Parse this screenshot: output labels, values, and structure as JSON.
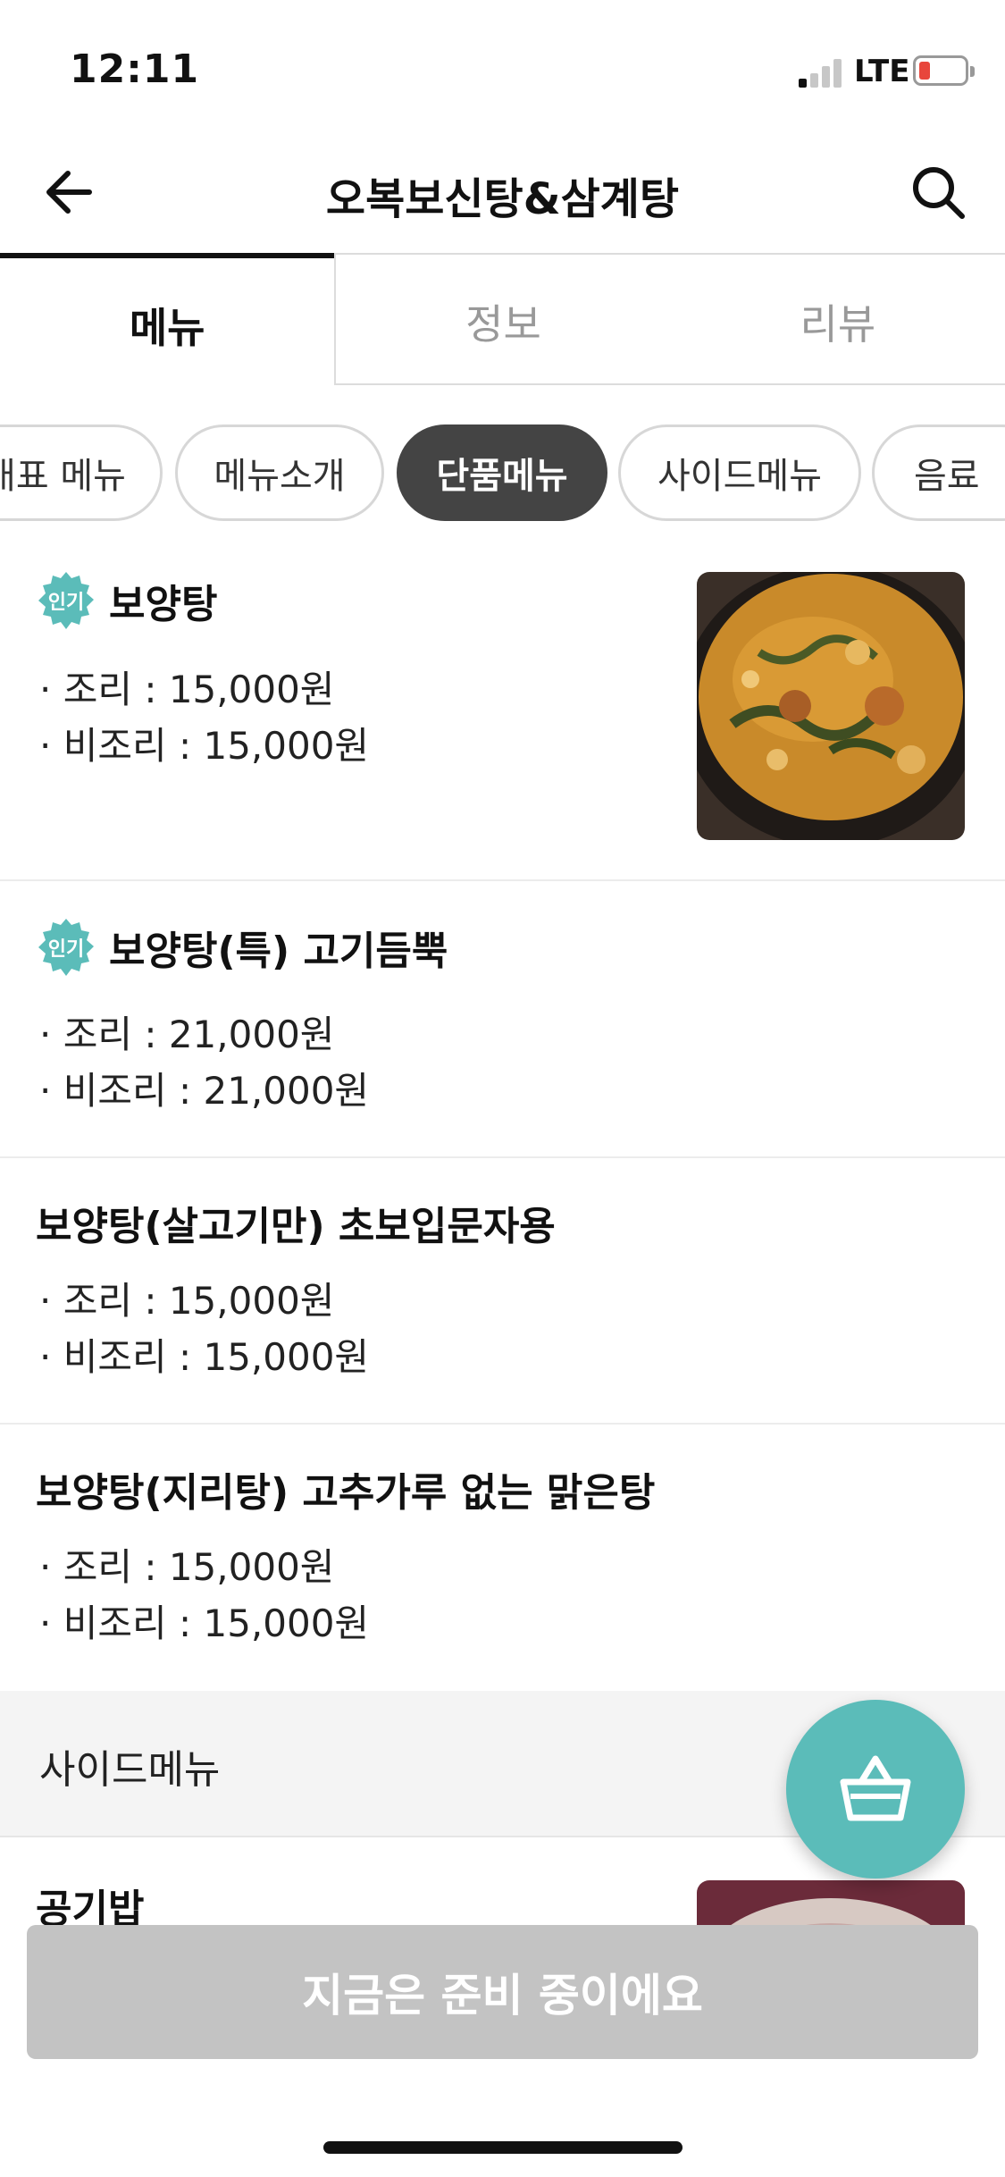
{
  "status_bar": {
    "time": "12:11",
    "network": "LTE"
  },
  "header": {
    "title": "오복보신탕&삼계탕",
    "back_icon": "arrow-left-icon",
    "search_icon": "search-icon"
  },
  "tabs": [
    {
      "label": "메뉴",
      "active": true
    },
    {
      "label": "정보",
      "active": false
    },
    {
      "label": "리뷰",
      "active": false
    }
  ],
  "category_chips": [
    {
      "label": "대표 메뉴",
      "active": false
    },
    {
      "label": "메뉴소개",
      "active": false
    },
    {
      "label": "단품메뉴",
      "active": true
    },
    {
      "label": "사이드메뉴",
      "active": false
    },
    {
      "label": "음료",
      "active": false
    }
  ],
  "menu_items": [
    {
      "badge": "인기",
      "name": "보양탕",
      "prices": [
        "· 조리 : 15,000원",
        "· 비조리 : 15,000원"
      ],
      "has_image": true
    },
    {
      "badge": "인기",
      "name": "보양탕(특) 고기듬뿍",
      "prices": [
        "· 조리 : 21,000원",
        "· 비조리 : 21,000원"
      ],
      "has_image": false
    },
    {
      "badge": "",
      "name": "보양탕(살고기만) 초보입문자용",
      "prices": [
        "· 조리 : 15,000원",
        "· 비조리 : 15,000원"
      ],
      "has_image": false
    },
    {
      "badge": "",
      "name": "보양탕(지리탕) 고추가루 없는 맑은탕",
      "prices": [
        "· 조리 : 15,000원",
        "· 비조리 : 15,000원"
      ],
      "has_image": false
    }
  ],
  "section": {
    "label": "사이드메뉴"
  },
  "side_items": [
    {
      "name": "공기밥",
      "has_image": true
    }
  ],
  "cart_fab": {
    "icon": "shopping-basket-icon"
  },
  "cta": {
    "label": "지금은 준비 중이에요"
  },
  "colors": {
    "accent": "#5bbcb9",
    "active_chip": "#444444",
    "cta_disabled": "#c3c3c3"
  }
}
